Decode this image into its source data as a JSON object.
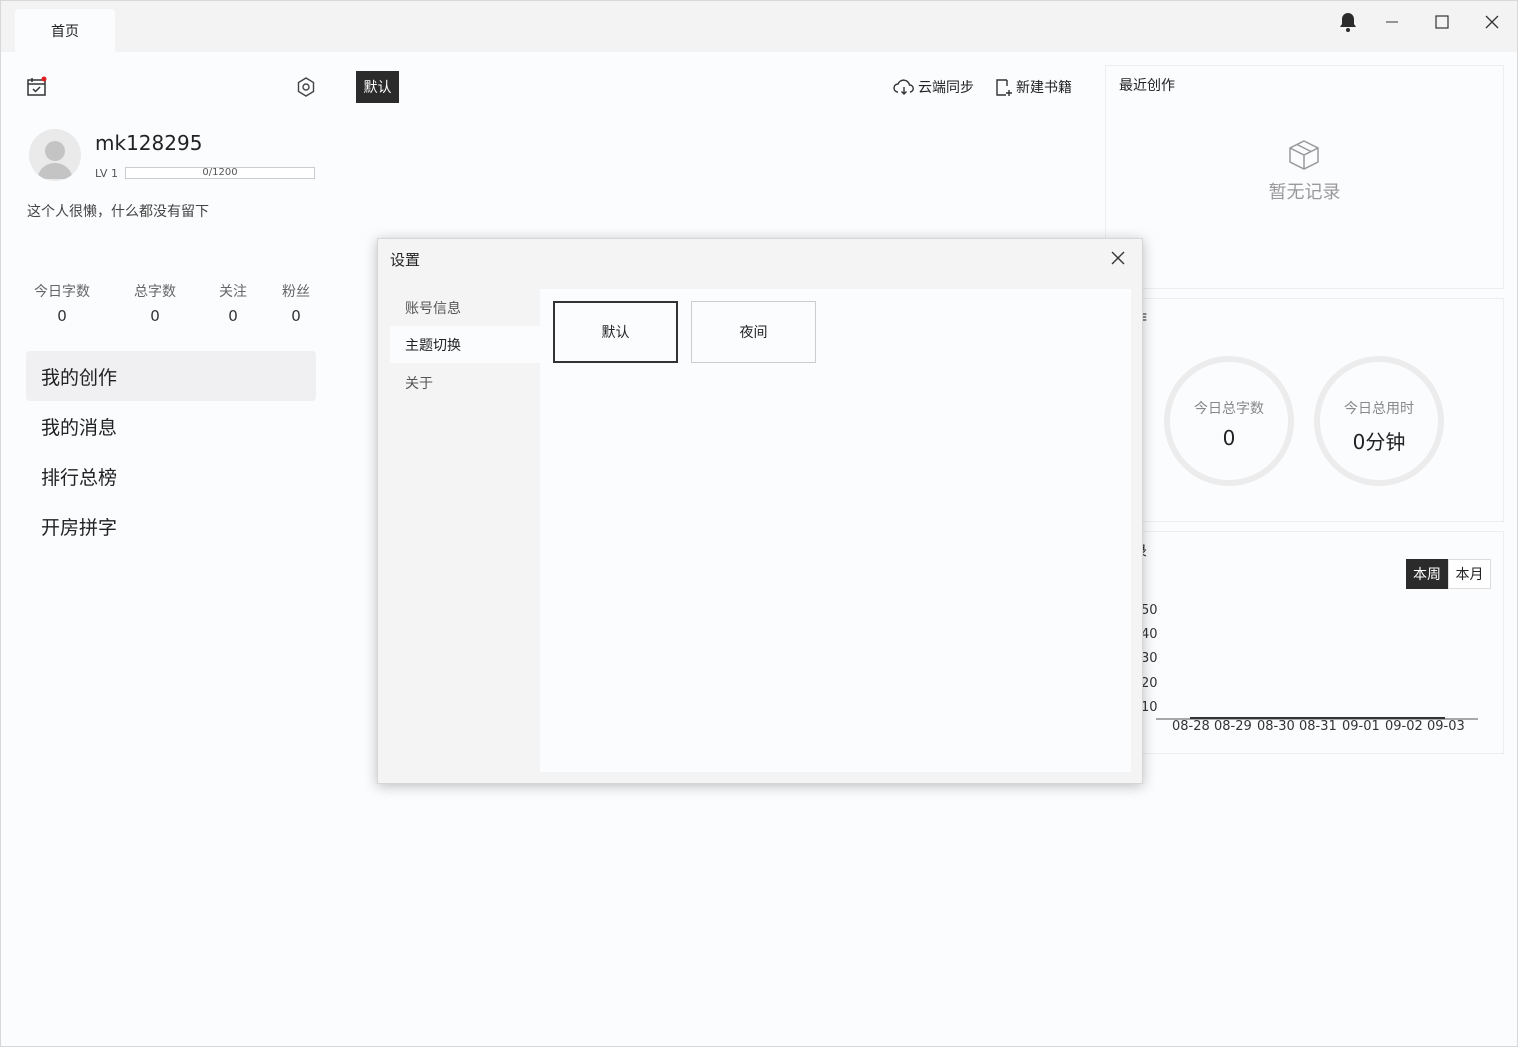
{
  "titlebar": {
    "tab_label": "首页"
  },
  "profile": {
    "username": "mk128295",
    "level": "LV 1",
    "exp": "0/1200",
    "bio": "这个人很懒，什么都没有留下"
  },
  "stats": [
    {
      "label": "今日字数",
      "value": "0"
    },
    {
      "label": "总字数",
      "value": "0"
    },
    {
      "label": "关注",
      "value": "0"
    },
    {
      "label": "粉丝",
      "value": "0"
    }
  ],
  "nav": [
    {
      "label": "我的创作"
    },
    {
      "label": "我的消息"
    },
    {
      "label": "排行总榜"
    },
    {
      "label": "开房拼字"
    }
  ],
  "toolbar": {
    "theme_tag": "默认",
    "cloud_sync": "云端同步",
    "new_book": "新建书籍"
  },
  "recent": {
    "title": "最近创作",
    "empty": "暂无记录"
  },
  "today": {
    "title": "创作",
    "words_label": "今日总字数",
    "words_value": "0",
    "time_label": "今日总用时",
    "time_value": "0分钟"
  },
  "records": {
    "title": "记录",
    "week": "本周",
    "month": "本月"
  },
  "chart_data": {
    "type": "line",
    "x": [
      "08-28",
      "08-29",
      "08-30",
      "08-31",
      "09-01",
      "09-02",
      "09-03"
    ],
    "y_ticks_visible": [
      "50",
      "40",
      "30",
      "20",
      "10"
    ],
    "series": [
      {
        "values": [
          0,
          0,
          0,
          0,
          0,
          0,
          0
        ]
      }
    ],
    "ylim": [
      0,
      50
    ]
  },
  "settings": {
    "title": "设置",
    "nav": [
      {
        "label": "账号信息"
      },
      {
        "label": "主题切换"
      },
      {
        "label": "关于"
      }
    ],
    "themes": [
      {
        "label": "默认"
      },
      {
        "label": "夜间"
      }
    ]
  }
}
